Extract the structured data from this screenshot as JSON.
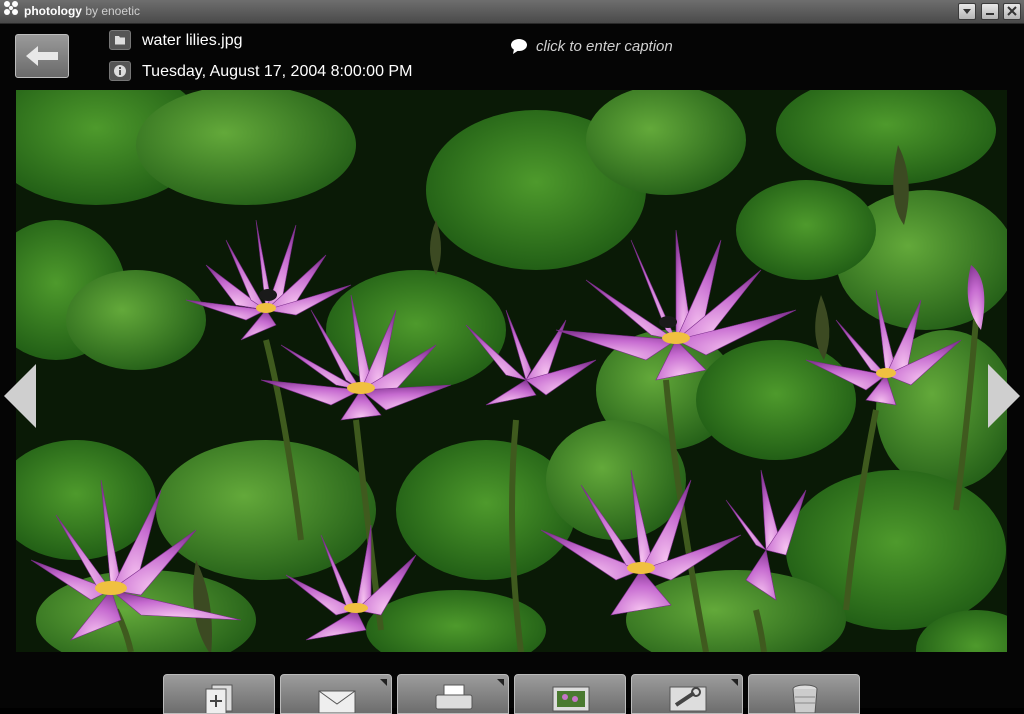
{
  "titlebar": {
    "app_name": "photology",
    "app_by": "by enoetic",
    "buttons": [
      "dropdown",
      "minimize",
      "close"
    ]
  },
  "photo_info": {
    "filename": "water lilies.jpg",
    "date": "Tuesday, August 17, 2004 8:00:00 PM",
    "caption_placeholder": "click to enter caption"
  },
  "toolbar": {
    "buttons": [
      {
        "name": "add-to-album",
        "icon": "add-photos-icon",
        "has_menu": false
      },
      {
        "name": "email",
        "icon": "envelope-icon",
        "has_menu": true
      },
      {
        "name": "print",
        "icon": "printer-icon",
        "has_menu": true
      },
      {
        "name": "set-wallpaper",
        "icon": "picture-icon",
        "has_menu": false
      },
      {
        "name": "edit-tools",
        "icon": "wrench-icon",
        "has_menu": true
      },
      {
        "name": "delete",
        "icon": "trash-icon",
        "has_menu": false
      }
    ]
  },
  "colors": {
    "background": "#000000",
    "text": "#ffffff",
    "caption": "#d0d0d0",
    "button_gray": "#8a8a8a"
  }
}
